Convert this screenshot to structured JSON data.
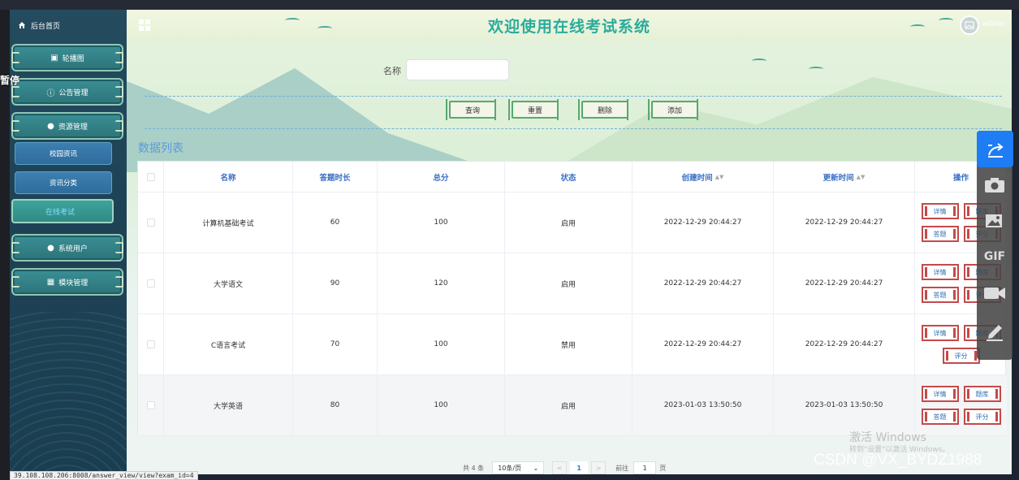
{
  "sidebar": {
    "home": "后台首页",
    "items": [
      {
        "label": "轮播图",
        "icon": "image-icon"
      },
      {
        "label": "公告管理",
        "icon": "info-icon"
      },
      {
        "label": "资源管理",
        "icon": "location-icon"
      }
    ],
    "subitems": [
      "校园资讯",
      "资讯分类"
    ],
    "active": "在线考试",
    "items2": [
      {
        "label": "系统用户",
        "icon": "user-icon"
      },
      {
        "label": "模块管理",
        "icon": "grid-icon"
      }
    ]
  },
  "overlay_text": "暂停",
  "header": {
    "title": "欢迎使用在线考试系统",
    "user": "admin"
  },
  "search": {
    "label": "名称",
    "value": ""
  },
  "actions": {
    "query": "查询",
    "reset": "重置",
    "delete": "删除",
    "add": "添加"
  },
  "list_title": "数据列表",
  "table": {
    "columns": [
      "名称",
      "答题时长",
      "总分",
      "状态",
      "创建时间",
      "更新时间",
      "操作"
    ],
    "rows": [
      {
        "name": "计算机基础考试",
        "duration": "60",
        "score": "100",
        "status": "启用",
        "created": "2022-12-29 20:44:27",
        "updated": "2022-12-29 20:44:27"
      },
      {
        "name": "大学语文",
        "duration": "90",
        "score": "120",
        "status": "启用",
        "created": "2022-12-29 20:44:27",
        "updated": "2022-12-29 20:44:27"
      },
      {
        "name": "C语言考试",
        "duration": "70",
        "score": "100",
        "status": "禁用",
        "created": "2022-12-29 20:44:27",
        "updated": "2022-12-29 20:44:27"
      },
      {
        "name": "大学英语",
        "duration": "80",
        "score": "100",
        "status": "启用",
        "created": "2023-01-03 13:50:50",
        "updated": "2023-01-03 13:50:50"
      }
    ],
    "ops": {
      "detail": "详情",
      "bank": "题库",
      "answer": "答题",
      "grade": "评分"
    }
  },
  "pager": {
    "total": "共 4 条",
    "size": "10条/页",
    "current": "1",
    "goto": "前往",
    "goto_value": "1",
    "unit": "页"
  },
  "float_icons": [
    "share-icon",
    "camera-icon",
    "image-icon",
    "gif-icon",
    "video-icon",
    "pen-icon"
  ],
  "gif_label": "GIF",
  "status_url": "39.108.108.206:8008/answer_view/view?exam_id=4",
  "win_watermark": "激活 Windows",
  "win_watermark_sub": "转到\"设置\"以激活 Windows。",
  "csdn_watermark": "CSDN @VX_BYDZ1988"
}
